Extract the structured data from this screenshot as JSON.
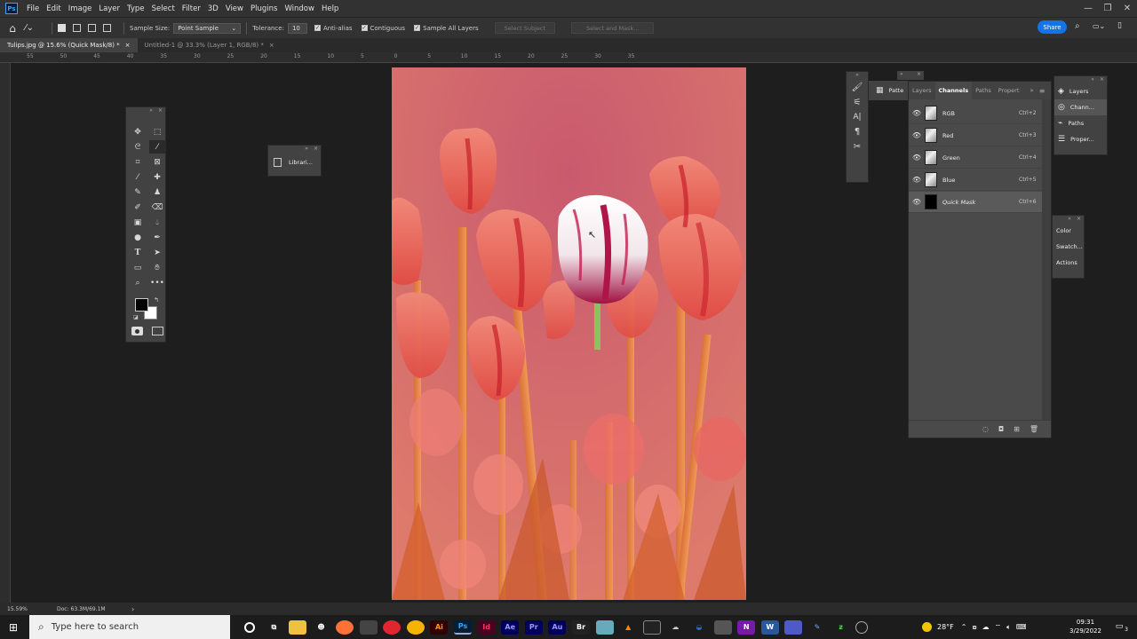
{
  "menubar": {
    "logo": "Ps",
    "items": [
      "File",
      "Edit",
      "Image",
      "Layer",
      "Type",
      "Select",
      "Filter",
      "3D",
      "View",
      "Plugins",
      "Window",
      "Help"
    ],
    "window_controls": [
      "—",
      "❐",
      "✕"
    ]
  },
  "options": {
    "sample_size_label": "Sample Size:",
    "sample_size_value": "Point Sample",
    "tolerance_label": "Tolerance:",
    "tolerance_value": "10",
    "anti_alias": "Anti-alias",
    "contiguous": "Contiguous",
    "sample_all_layers": "Sample All Layers",
    "select_subject": "Select Subject",
    "select_and_mask": "Select and Mask...",
    "share": "Share"
  },
  "tabs": [
    {
      "label": "Tulips.jpg @ 15.6% (Quick Mask/8) *",
      "close": "×"
    },
    {
      "label": "Untitled-1 @ 33.3% (Layer 1, RGB/8) *",
      "close": "×"
    }
  ],
  "ruler": {
    "top_ticks": [
      "55",
      "50",
      "45",
      "40",
      "35",
      "30",
      "25",
      "20",
      "15",
      "10",
      "5",
      "0",
      "5",
      "10",
      "15",
      "20",
      "25",
      "30",
      "35"
    ]
  },
  "libraries": {
    "label": "Librari..."
  },
  "patterns": {
    "label": "Patte"
  },
  "channels_panel": {
    "tabs": [
      "Layers",
      "Channels",
      "Paths",
      "Propert"
    ],
    "rows": [
      {
        "name": "RGB",
        "shortcut": "Ctrl+2"
      },
      {
        "name": "Red",
        "shortcut": "Ctrl+3"
      },
      {
        "name": "Green",
        "shortcut": "Ctrl+4"
      },
      {
        "name": "Blue",
        "shortcut": "Ctrl+5"
      },
      {
        "name": "Quick Mask",
        "shortcut": "Ctrl+6"
      }
    ]
  },
  "right_panel": {
    "items": [
      "Layers",
      "Chann...",
      "Paths",
      "Proper..."
    ]
  },
  "right_panel2": {
    "items": [
      "Color",
      "Swatch...",
      "Actions"
    ]
  },
  "status": {
    "zoom": "15.59%",
    "doc": "Doc: 63.3M/69.1M",
    "arrow": "›"
  },
  "taskbar": {
    "search_placeholder": "Type here to search",
    "weather": "28°F",
    "time": "09:31",
    "date": "3/29/2022",
    "notifications": "3"
  },
  "colors": {
    "accent": "#1473e6",
    "app_bg": "#1e1e1e",
    "panel_bg": "#424242"
  }
}
